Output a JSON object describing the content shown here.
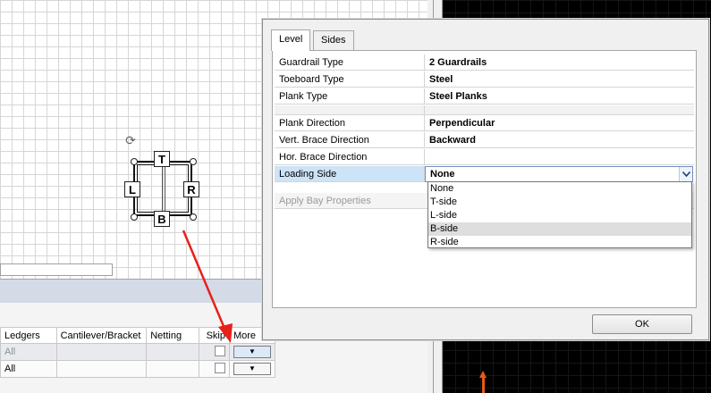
{
  "bay_plan": {
    "top_label": "T",
    "left_label": "L",
    "right_label": "R",
    "bottom_label": "B"
  },
  "dialog": {
    "tabs": [
      {
        "label": "Level",
        "active": true
      },
      {
        "label": "Sides",
        "active": false
      }
    ],
    "properties": [
      {
        "key": "Guardrail Type",
        "value": "2 Guardrails"
      },
      {
        "key": "Toeboard Type",
        "value": "Steel"
      },
      {
        "key": "Plank Type",
        "value": "Steel Planks"
      },
      {
        "key": "Plank Direction",
        "value": "Perpendicular"
      },
      {
        "key": "Vert. Brace Direction",
        "value": "Backward"
      },
      {
        "key": "Hor. Brace Direction",
        "value": ""
      },
      {
        "key": "Loading Side",
        "value": "None"
      },
      {
        "key": "Apply Bay Properties",
        "value": ""
      }
    ],
    "loading_side_options": [
      "None",
      "T-side",
      "L-side",
      "B-side",
      "R-side"
    ],
    "highlighted_option": "B-side",
    "ok_label": "OK"
  },
  "bottom_table": {
    "columns": [
      "Ledgers",
      "Cantilever/Bracket",
      "Netting",
      "Skip",
      "More"
    ],
    "rows": [
      {
        "ledgers": "All"
      },
      {
        "ledgers": "All"
      }
    ],
    "dropdown_glyph": "▼"
  },
  "colors": {
    "selection": "#cde3f7",
    "annotation_arrow": "#e8201a",
    "axis": "#e85a1a"
  }
}
